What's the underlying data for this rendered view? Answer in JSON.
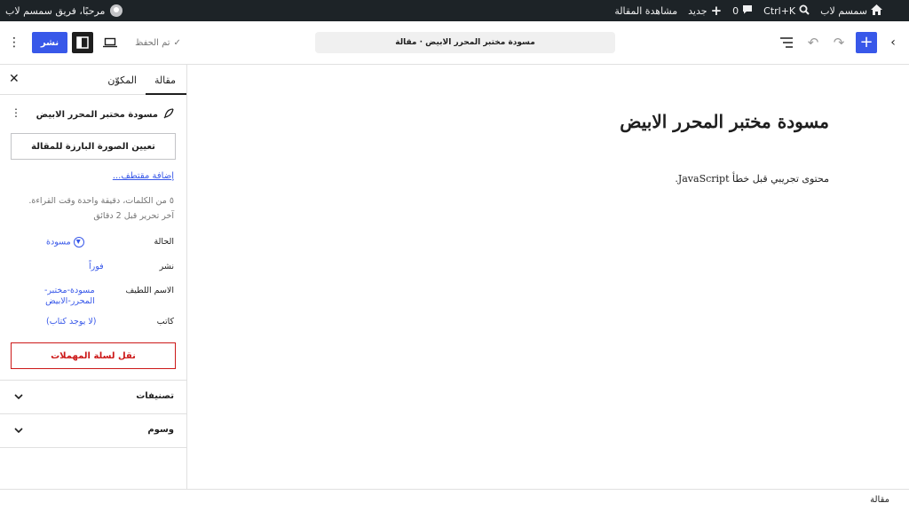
{
  "admin_bar": {
    "site_name": "سمسم لاب",
    "search_shortcut": "Ctrl+K",
    "comments_count": "0",
    "new_label": "جديد",
    "view_post": "مشاهدة المقالة",
    "greeting": "مرحبًا، فريق سمسم لاب"
  },
  "header": {
    "publish": "نشر",
    "saved": "تم الحفظ",
    "document_title": "مسودة مختبر المحرر الابيض · مقالة"
  },
  "sidebar": {
    "tabs": {
      "post": "مقالة",
      "block": "المكوّن"
    },
    "post_summary_title": "مسودة مختبر المحرر الابيض",
    "featured_image_button": "تعيين الصورة البارزة للمقالة",
    "add_excerpt": "إضافة مقتطف...",
    "stats_line1": "٥ من الكلمات، دقيقة واحدة وقت القراءة.",
    "stats_line2": "آخر تحرير قبل 2 دقائق",
    "meta": {
      "status_label": "الحالة",
      "status_value": "مسودة",
      "publish_label": "نشر",
      "publish_value": "فوراً",
      "slug_label": "الاسم اللطيف",
      "slug_value_line1": "مسودة-مختبر-",
      "slug_value_line2": "المحرر-الابيض",
      "author_label": "كاتب",
      "author_value": "(لا يوجد كتاب)"
    },
    "trash_button": "نقل لسلة المهملات",
    "panels": {
      "categories": "تصنيفات",
      "tags": "وسوم"
    }
  },
  "canvas": {
    "title": "مسودة مختبر المحرر الابيض",
    "content": "محتوى تجريبي قبل خطأ JavaScript."
  },
  "footer": {
    "breadcrumb": "مقالة"
  },
  "colors": {
    "accent": "#3858e9",
    "admin_bar": "#1d2327",
    "danger": "#cc1818"
  }
}
